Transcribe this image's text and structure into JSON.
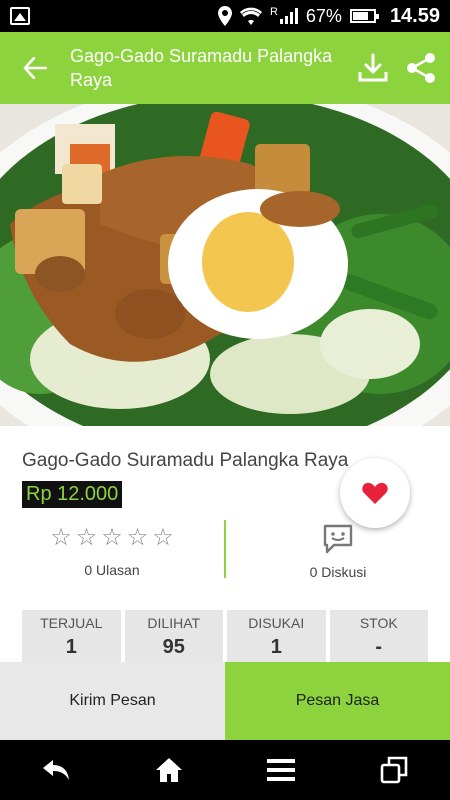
{
  "status_bar": {
    "battery": "67%",
    "time": "14.59",
    "signal_label": "R",
    "icons": [
      "gallery-icon",
      "location-icon",
      "wifi-icon",
      "signal-icon",
      "battery-icon"
    ]
  },
  "app_bar": {
    "title": "Gago-Gado Suramadu Palangka Raya",
    "back_icon": "arrow-left-icon",
    "download_icon": "download-icon",
    "share_icon": "share-icon"
  },
  "product": {
    "name": "Gago-Gado Suramadu Palangka Raya",
    "price": "Rp 12.000",
    "rating_stars": 0,
    "reviews": "0 Ulasan",
    "discussions": "0 Diskusi"
  },
  "stats": [
    {
      "label": "TERJUAL",
      "value": "1"
    },
    {
      "label": "DILIHAT",
      "value": "95"
    },
    {
      "label": "DISUKAI",
      "value": "1"
    },
    {
      "label": "STOK",
      "value": "-"
    }
  ],
  "actions": {
    "send_message": "Kirim Pesan",
    "order_service": "Pesan Jasa"
  },
  "colors": {
    "accent": "#8cd33e",
    "favorite": "#e8213a"
  }
}
